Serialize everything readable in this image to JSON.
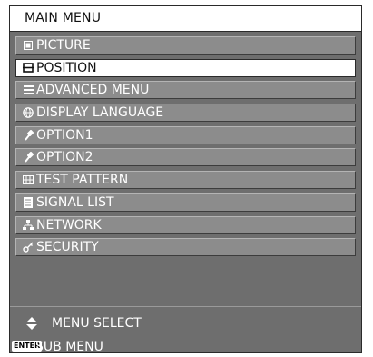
{
  "menu": {
    "title": "MAIN MENU",
    "items": [
      {
        "label": "PICTURE",
        "icon": "picture-icon",
        "selected": false
      },
      {
        "label": "POSITION",
        "icon": "position-icon",
        "selected": true
      },
      {
        "label": "ADVANCED MENU",
        "icon": "advanced-menu-icon",
        "selected": false
      },
      {
        "label": "DISPLAY LANGUAGE",
        "icon": "globe-icon",
        "selected": false
      },
      {
        "label": "OPTION1",
        "icon": "wrench-icon",
        "selected": false
      },
      {
        "label": "OPTION2",
        "icon": "wrench-icon",
        "selected": false
      },
      {
        "label": "TEST PATTERN",
        "icon": "test-pattern-icon",
        "selected": false
      },
      {
        "label": "SIGNAL LIST",
        "icon": "signal-list-icon",
        "selected": false
      },
      {
        "label": "NETWORK",
        "icon": "network-icon",
        "selected": false
      },
      {
        "label": "SECURITY",
        "icon": "key-icon",
        "selected": false
      }
    ]
  },
  "footer": {
    "select_hint": "MENU SELECT",
    "enter_key_label": "ENTER",
    "enter_hint": "SUB MENU"
  },
  "colors": {
    "panel_background": "#6e6e6e",
    "item_background": "#8c8c8c",
    "selected_background": "#ffffff"
  }
}
